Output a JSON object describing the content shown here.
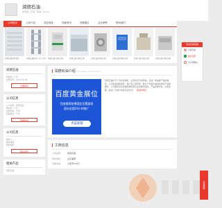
{
  "header": {
    "site_name": "润德石油",
    "tags": "润滑油，石油，柴油，Diesel"
  },
  "nav": [
    "公司首页",
    "公司介绍",
    "供应商品",
    "商家资讯",
    "商家图片",
    "企业荣誉",
    "联系我们"
  ],
  "photos": [
    {
      "caption": "润德石油对外出售"
    },
    {
      "caption": "润德石油出售厂房厂房对外出租"
    },
    {
      "caption": "润德石油 润德石油"
    },
    {
      "caption": "润德石油 润德石油"
    },
    {
      "caption": "润德石油 润德石油"
    },
    {
      "caption": "润德石油 润德石油"
    },
    {
      "caption": "润德石油 润德石油"
    },
    {
      "caption": "润德石油 润德石油"
    }
  ],
  "store_card": {
    "title": "润德石油",
    "lines": [
      "所在地：广东",
      "注册时间：2011-01-08"
    ],
    "button": "立即联系"
  },
  "company_card": {
    "title": "公司信息",
    "lines": [
      "公司名称：润德石油",
      "所在地：广东",
      "注册资本：不详",
      "经营模式：不详"
    ],
    "button": "查看更多"
  },
  "goods_card": {
    "title": "公司信息",
    "lines": [
      "联系人：",
      "联系电话：",
      "所在地区："
    ],
    "button": "联系商家"
  },
  "goods_card2": {
    "title": "相关产品",
    "lines": [
      "润德石油"
    ]
  },
  "intro_panel": {
    "title": "润德石油介绍",
    "sub": "Company Introduction",
    "text": "润德石油位于广东省某地区，主营业务为润滑油、石油、柴油等产品的销售。公司本着诚信经营、客户至上的原则，致力于为客户提供优质的产品和服务。公司拥有完善的销售网络和专业的服务团队，产品质量可靠，价格合理，欢迎广大客户前来洽谈合作。",
    "more": "【查看详情】"
  },
  "ad": {
    "title": "百度黄金展位",
    "line1": "百度搜索结果固定位置展现",
    "line2": "面向全国24小时推广",
    "button": "点击获取"
  },
  "facts_panel": {
    "title": "工商信息",
    "rows": [
      {
        "label": "公司名称：",
        "value": "润德石油"
      },
      {
        "label": "所在地区：",
        "value": "山东淄博"
      },
      {
        "label": "注册资本：",
        "value": "人民币100万"
      }
    ]
  },
  "float_panel": {
    "head": "手机扫码查看",
    "items": [
      "扫码查看",
      "微信扫码",
      "分享到微信"
    ]
  },
  "contact_tab": "在线客服",
  "colors": {
    "accent": "#e8392b",
    "ad_blue": "#1c55d6",
    "bg": "#ececec"
  }
}
